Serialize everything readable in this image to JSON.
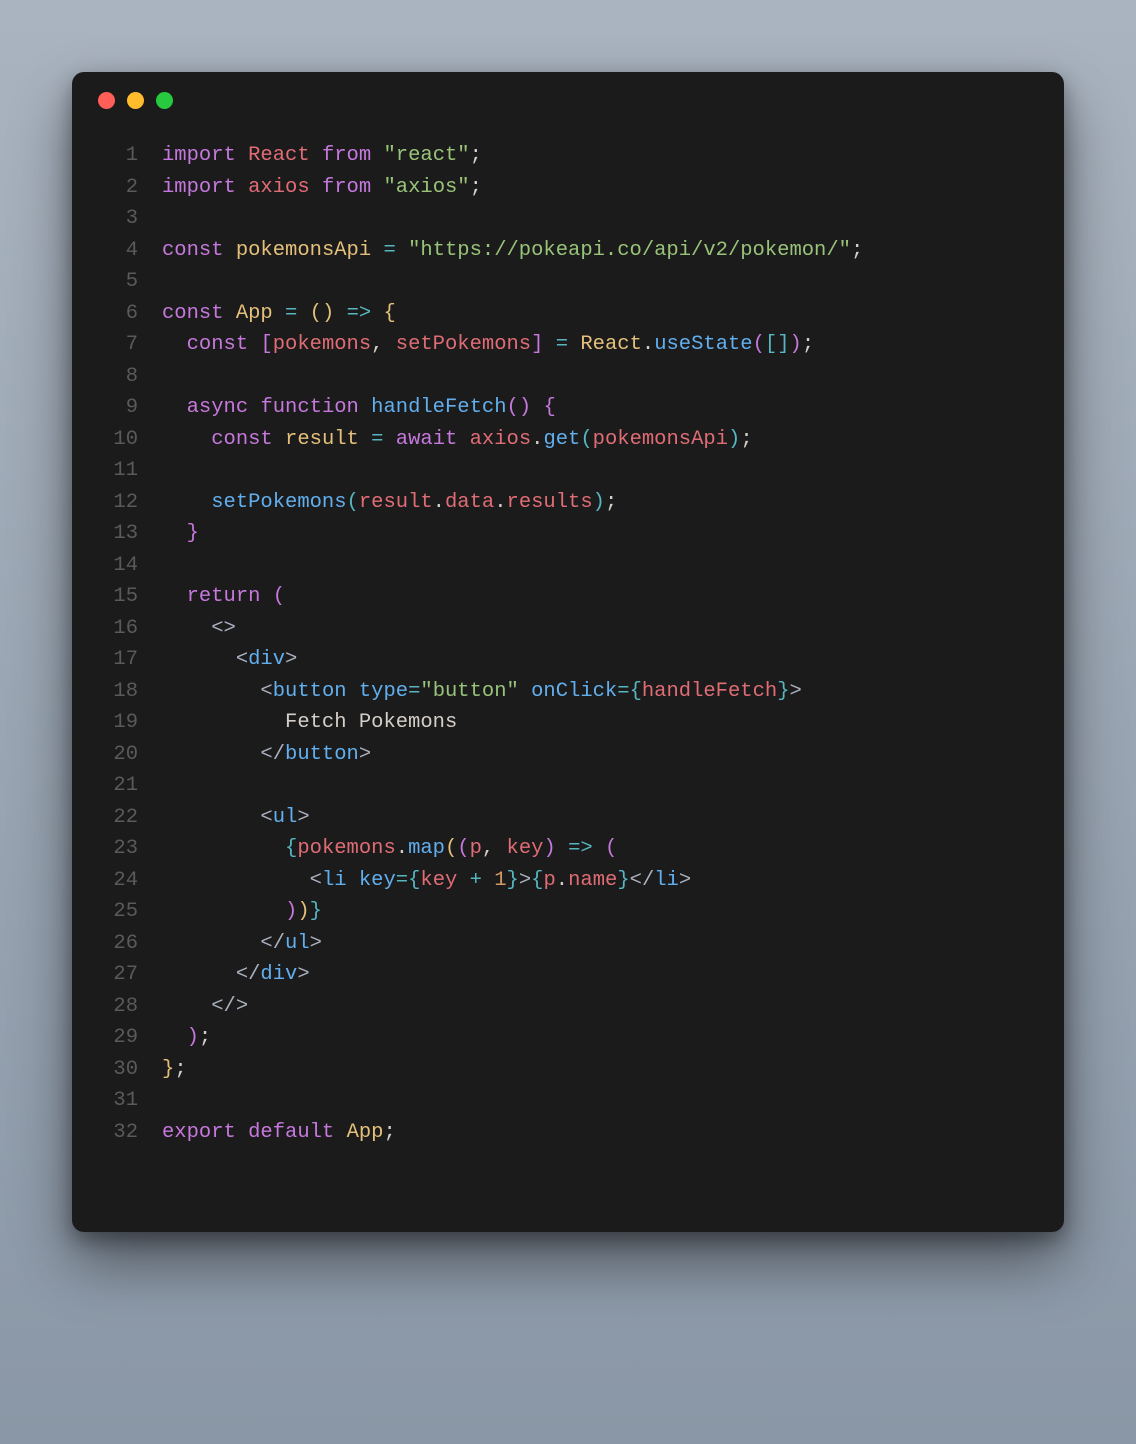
{
  "window": {
    "traffic_lights": [
      "close",
      "minimize",
      "zoom"
    ]
  },
  "code": {
    "lines": [
      {
        "n": 1,
        "tokens": [
          [
            "kw",
            "import"
          ],
          [
            "plain",
            " "
          ],
          [
            "id",
            "React"
          ],
          [
            "plain",
            " "
          ],
          [
            "kw",
            "from"
          ],
          [
            "plain",
            " "
          ],
          [
            "str",
            "\"react\""
          ],
          [
            "punc",
            ";"
          ]
        ]
      },
      {
        "n": 2,
        "tokens": [
          [
            "kw",
            "import"
          ],
          [
            "plain",
            " "
          ],
          [
            "id",
            "axios"
          ],
          [
            "plain",
            " "
          ],
          [
            "kw",
            "from"
          ],
          [
            "plain",
            " "
          ],
          [
            "str",
            "\"axios\""
          ],
          [
            "punc",
            ";"
          ]
        ]
      },
      {
        "n": 3,
        "tokens": []
      },
      {
        "n": 4,
        "tokens": [
          [
            "kw",
            "const"
          ],
          [
            "plain",
            " "
          ],
          [
            "cls",
            "pokemonsApi"
          ],
          [
            "plain",
            " "
          ],
          [
            "op",
            "="
          ],
          [
            "plain",
            " "
          ],
          [
            "str",
            "\"https://pokeapi.co/api/v2/pokemon/\""
          ],
          [
            "punc",
            ";"
          ]
        ]
      },
      {
        "n": 5,
        "tokens": []
      },
      {
        "n": 6,
        "tokens": [
          [
            "kw",
            "const"
          ],
          [
            "plain",
            " "
          ],
          [
            "cls",
            "App"
          ],
          [
            "plain",
            " "
          ],
          [
            "op",
            "="
          ],
          [
            "plain",
            " "
          ],
          [
            "brkt",
            "("
          ],
          [
            "brkt",
            ")"
          ],
          [
            "plain",
            " "
          ],
          [
            "op",
            "=>"
          ],
          [
            "plain",
            " "
          ],
          [
            "brkt",
            "{"
          ]
        ]
      },
      {
        "n": 7,
        "tokens": [
          [
            "plain",
            "  "
          ],
          [
            "kw",
            "const"
          ],
          [
            "plain",
            " "
          ],
          [
            "brkp",
            "["
          ],
          [
            "id",
            "pokemons"
          ],
          [
            "punc",
            ", "
          ],
          [
            "id",
            "setPokemons"
          ],
          [
            "brkp",
            "]"
          ],
          [
            "plain",
            " "
          ],
          [
            "op",
            "="
          ],
          [
            "plain",
            " "
          ],
          [
            "cls",
            "React"
          ],
          [
            "punc",
            "."
          ],
          [
            "fn",
            "useState"
          ],
          [
            "brkp",
            "("
          ],
          [
            "brkb",
            "["
          ],
          [
            "brkb",
            "]"
          ],
          [
            "brkp",
            ")"
          ],
          [
            "punc",
            ";"
          ]
        ]
      },
      {
        "n": 8,
        "tokens": []
      },
      {
        "n": 9,
        "tokens": [
          [
            "plain",
            "  "
          ],
          [
            "kw",
            "async"
          ],
          [
            "plain",
            " "
          ],
          [
            "kw",
            "function"
          ],
          [
            "plain",
            " "
          ],
          [
            "fn",
            "handleFetch"
          ],
          [
            "brkp",
            "("
          ],
          [
            "brkp",
            ")"
          ],
          [
            "plain",
            " "
          ],
          [
            "brkp",
            "{"
          ]
        ]
      },
      {
        "n": 10,
        "tokens": [
          [
            "plain",
            "    "
          ],
          [
            "kw",
            "const"
          ],
          [
            "plain",
            " "
          ],
          [
            "cls",
            "result"
          ],
          [
            "plain",
            " "
          ],
          [
            "op",
            "="
          ],
          [
            "plain",
            " "
          ],
          [
            "kw",
            "await"
          ],
          [
            "plain",
            " "
          ],
          [
            "id",
            "axios"
          ],
          [
            "punc",
            "."
          ],
          [
            "fn",
            "get"
          ],
          [
            "brkb",
            "("
          ],
          [
            "id",
            "pokemonsApi"
          ],
          [
            "brkb",
            ")"
          ],
          [
            "punc",
            ";"
          ]
        ]
      },
      {
        "n": 11,
        "tokens": []
      },
      {
        "n": 12,
        "tokens": [
          [
            "plain",
            "    "
          ],
          [
            "fn",
            "setPokemons"
          ],
          [
            "brkb",
            "("
          ],
          [
            "id",
            "result"
          ],
          [
            "punc",
            "."
          ],
          [
            "id",
            "data"
          ],
          [
            "punc",
            "."
          ],
          [
            "id",
            "results"
          ],
          [
            "brkb",
            ")"
          ],
          [
            "punc",
            ";"
          ]
        ]
      },
      {
        "n": 13,
        "tokens": [
          [
            "plain",
            "  "
          ],
          [
            "brkp",
            "}"
          ]
        ]
      },
      {
        "n": 14,
        "tokens": []
      },
      {
        "n": 15,
        "tokens": [
          [
            "plain",
            "  "
          ],
          [
            "kw",
            "return"
          ],
          [
            "plain",
            " "
          ],
          [
            "brkp",
            "("
          ]
        ]
      },
      {
        "n": 16,
        "tokens": [
          [
            "plain",
            "    "
          ],
          [
            "ang",
            "<>"
          ]
        ]
      },
      {
        "n": 17,
        "tokens": [
          [
            "plain",
            "      "
          ],
          [
            "ang",
            "<"
          ],
          [
            "fn",
            "div"
          ],
          [
            "ang",
            ">"
          ]
        ]
      },
      {
        "n": 18,
        "tokens": [
          [
            "plain",
            "        "
          ],
          [
            "ang",
            "<"
          ],
          [
            "fn",
            "button"
          ],
          [
            "plain",
            " "
          ],
          [
            "fn",
            "type"
          ],
          [
            "op",
            "="
          ],
          [
            "str",
            "\"button\""
          ],
          [
            "plain",
            " "
          ],
          [
            "fn",
            "onClick"
          ],
          [
            "op",
            "="
          ],
          [
            "brkb",
            "{"
          ],
          [
            "id",
            "handleFetch"
          ],
          [
            "brkb",
            "}"
          ],
          [
            "ang",
            ">"
          ]
        ]
      },
      {
        "n": 19,
        "tokens": [
          [
            "plain",
            "          "
          ],
          [
            "txt",
            "Fetch Pokemons"
          ]
        ]
      },
      {
        "n": 20,
        "tokens": [
          [
            "plain",
            "        "
          ],
          [
            "ang",
            "</"
          ],
          [
            "fn",
            "button"
          ],
          [
            "ang",
            ">"
          ]
        ]
      },
      {
        "n": 21,
        "tokens": []
      },
      {
        "n": 22,
        "tokens": [
          [
            "plain",
            "        "
          ],
          [
            "ang",
            "<"
          ],
          [
            "fn",
            "ul"
          ],
          [
            "ang",
            ">"
          ]
        ]
      },
      {
        "n": 23,
        "tokens": [
          [
            "plain",
            "          "
          ],
          [
            "brkb",
            "{"
          ],
          [
            "id",
            "pokemons"
          ],
          [
            "punc",
            "."
          ],
          [
            "fn",
            "map"
          ],
          [
            "brkt",
            "("
          ],
          [
            "brkp",
            "("
          ],
          [
            "id",
            "p"
          ],
          [
            "punc",
            ", "
          ],
          [
            "id",
            "key"
          ],
          [
            "brkp",
            ")"
          ],
          [
            "plain",
            " "
          ],
          [
            "op",
            "=>"
          ],
          [
            "plain",
            " "
          ],
          [
            "brkp",
            "("
          ]
        ]
      },
      {
        "n": 24,
        "tokens": [
          [
            "plain",
            "            "
          ],
          [
            "ang",
            "<"
          ],
          [
            "fn",
            "li"
          ],
          [
            "plain",
            " "
          ],
          [
            "fn",
            "key"
          ],
          [
            "op",
            "="
          ],
          [
            "brkb",
            "{"
          ],
          [
            "id",
            "key"
          ],
          [
            "plain",
            " "
          ],
          [
            "op",
            "+"
          ],
          [
            "plain",
            " "
          ],
          [
            "num",
            "1"
          ],
          [
            "brkb",
            "}"
          ],
          [
            "ang",
            ">"
          ],
          [
            "brkb",
            "{"
          ],
          [
            "id",
            "p"
          ],
          [
            "punc",
            "."
          ],
          [
            "id",
            "name"
          ],
          [
            "brkb",
            "}"
          ],
          [
            "ang",
            "</"
          ],
          [
            "fn",
            "li"
          ],
          [
            "ang",
            ">"
          ]
        ]
      },
      {
        "n": 25,
        "tokens": [
          [
            "plain",
            "          "
          ],
          [
            "brkp",
            ")"
          ],
          [
            "brkt",
            ")"
          ],
          [
            "brkb",
            "}"
          ]
        ]
      },
      {
        "n": 26,
        "tokens": [
          [
            "plain",
            "        "
          ],
          [
            "ang",
            "</"
          ],
          [
            "fn",
            "ul"
          ],
          [
            "ang",
            ">"
          ]
        ]
      },
      {
        "n": 27,
        "tokens": [
          [
            "plain",
            "      "
          ],
          [
            "ang",
            "</"
          ],
          [
            "fn",
            "div"
          ],
          [
            "ang",
            ">"
          ]
        ]
      },
      {
        "n": 28,
        "tokens": [
          [
            "plain",
            "    "
          ],
          [
            "ang",
            "</>"
          ]
        ]
      },
      {
        "n": 29,
        "tokens": [
          [
            "plain",
            "  "
          ],
          [
            "brkp",
            ")"
          ],
          [
            "punc",
            ";"
          ]
        ]
      },
      {
        "n": 30,
        "tokens": [
          [
            "brkt",
            "}"
          ],
          [
            "punc",
            ";"
          ]
        ]
      },
      {
        "n": 31,
        "tokens": []
      },
      {
        "n": 32,
        "tokens": [
          [
            "kw",
            "export"
          ],
          [
            "plain",
            " "
          ],
          [
            "kw",
            "default"
          ],
          [
            "plain",
            " "
          ],
          [
            "cls",
            "App"
          ],
          [
            "punc",
            ";"
          ]
        ]
      }
    ]
  }
}
